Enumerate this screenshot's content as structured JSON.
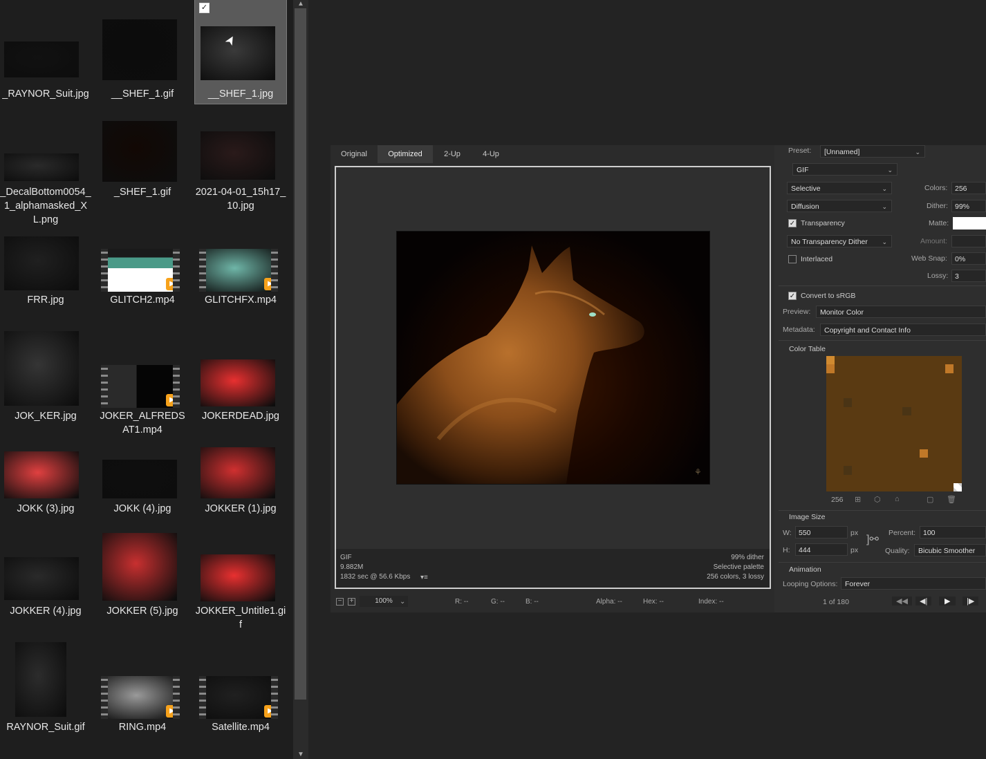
{
  "explorer": {
    "files": [
      {
        "name": "_RAYNOR_Suit.jpg",
        "kind": "image",
        "selected": false
      },
      {
        "name": "__SHEF_1.gif",
        "kind": "image",
        "selected": false
      },
      {
        "name": "__SHEF_1.jpg",
        "kind": "image",
        "selected": true
      },
      {
        "name": "_DecalBottom0054_1_alphamasked_XL.png",
        "kind": "image",
        "selected": false
      },
      {
        "name": "_SHEF_1.gif",
        "kind": "image",
        "selected": false
      },
      {
        "name": "2021-04-01_15h17_10.jpg",
        "kind": "image",
        "selected": false
      },
      {
        "name": "FRR.jpg",
        "kind": "image",
        "selected": false
      },
      {
        "name": "GLITCH2.mp4",
        "kind": "video",
        "selected": false
      },
      {
        "name": "GLITCHFX.mp4",
        "kind": "video",
        "selected": false
      },
      {
        "name": "JOK_KER.jpg",
        "kind": "image",
        "selected": false
      },
      {
        "name": "JOKER_ALFREDSAT1.mp4",
        "kind": "video",
        "selected": false
      },
      {
        "name": "JOKERDEAD.jpg",
        "kind": "image",
        "selected": false
      },
      {
        "name": "JOKK (3).jpg",
        "kind": "image",
        "selected": false
      },
      {
        "name": "JOKK (4).jpg",
        "kind": "image",
        "selected": false
      },
      {
        "name": "JOKKER (1).jpg",
        "kind": "image",
        "selected": false
      },
      {
        "name": "JOKKER (4).jpg",
        "kind": "image",
        "selected": false
      },
      {
        "name": "JOKKER (5).jpg",
        "kind": "image",
        "selected": false
      },
      {
        "name": "JOKKER_Untitle1.gif",
        "kind": "image",
        "selected": false
      },
      {
        "name": "RAYNOR_Suit.gif",
        "kind": "image",
        "selected": false
      },
      {
        "name": "RING.mp4",
        "kind": "video",
        "selected": false
      },
      {
        "name": "Satellite.mp4",
        "kind": "video",
        "selected": false
      }
    ]
  },
  "dialog": {
    "tabs": [
      "Original",
      "Optimized",
      "2-Up",
      "4-Up"
    ],
    "active_tab": "Optimized",
    "info_left": [
      "GIF",
      "9.882M",
      "1832 sec @ 56.6 Kbps"
    ],
    "info_right": [
      "99% dither",
      "Selective palette",
      "256 colors, 3 lossy"
    ],
    "zoom": "100%",
    "readouts": {
      "r": "R: --",
      "g": "G: --",
      "b": "B: --",
      "alpha": "Alpha: --",
      "hex": "Hex: --",
      "index": "Index: --"
    }
  },
  "panel": {
    "preset_label": "Preset:",
    "preset_value": "[Unnamed]",
    "format": "GIF",
    "reduction": "Selective",
    "dither_algo": "Diffusion",
    "transparency_label": "Transparency",
    "transparency_checked": true,
    "transparency_dither": "No Transparency Dither",
    "interlaced_label": "Interlaced",
    "interlaced_checked": false,
    "colors_label": "Colors:",
    "colors_value": "256",
    "dither_label": "Dither:",
    "dither_value": "99%",
    "matte_label": "Matte:",
    "amount_label": "Amount:",
    "websnap_label": "Web Snap:",
    "websnap_value": "0%",
    "lossy_label": "Lossy:",
    "lossy_value": "3",
    "convert_label": "Convert to sRGB",
    "convert_checked": true,
    "preview_label": "Preview:",
    "preview_value": "Monitor Color",
    "metadata_label": "Metadata:",
    "metadata_value": "Copyright and Contact Info",
    "color_table_label": "Color Table",
    "color_count": "256",
    "image_size_label": "Image Size",
    "w_label": "W:",
    "w_value": "550",
    "h_label": "H:",
    "h_value": "444",
    "px": "px",
    "percent_label": "Percent:",
    "percent_value": "100",
    "quality_label": "Quality:",
    "quality_value": "Bicubic Smoother",
    "animation_label": "Animation",
    "looping_label": "Looping Options:",
    "looping_value": "Forever",
    "frame_counter": "1 of 180"
  },
  "colors": {
    "palette": [
      "#5a3a12",
      "#8a5520",
      "#b06a25",
      "#3c2a10",
      "#d08a30",
      "#6b4a1a",
      "#2a1a08",
      "#9a6a2a",
      "#c07828",
      "#4a3415",
      "#e09a40",
      "#704818",
      "#a88040",
      "#1c1208",
      "#7a6030",
      "#c89040"
    ],
    "accent_orange": "#f7a21b"
  }
}
